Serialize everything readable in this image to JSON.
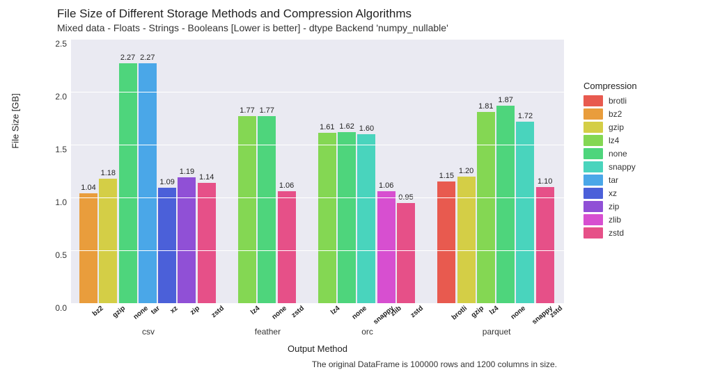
{
  "chart_data": {
    "type": "bar",
    "title": "File Size of Different Storage Methods and Compression Algorithms",
    "subtitle": "Mixed data - Floats - Strings - Booleans [Lower is better] - dtype Backend 'numpy_nullable'",
    "xlabel": "Output Method",
    "ylabel": "File Size [GB]",
    "ylim": [
      0.0,
      2.5
    ],
    "yticks": [
      0.0,
      0.5,
      1.0,
      1.5,
      2.0,
      2.5
    ],
    "legend_title": "Compression",
    "footnote": "The original DataFrame is 100000 rows and 1200 columns in size.",
    "compressions": [
      {
        "name": "brotli",
        "color": "#e85a4f"
      },
      {
        "name": "bz2",
        "color": "#e99d3c"
      },
      {
        "name": "gzip",
        "color": "#d4ce46"
      },
      {
        "name": "lz4",
        "color": "#84d753"
      },
      {
        "name": "none",
        "color": "#4ed57c"
      },
      {
        "name": "snappy",
        "color": "#49d4bd"
      },
      {
        "name": "tar",
        "color": "#4aa7e8"
      },
      {
        "name": "xz",
        "color": "#4b60d9"
      },
      {
        "name": "zip",
        "color": "#9050d6"
      },
      {
        "name": "zlib",
        "color": "#d74fd0"
      },
      {
        "name": "zstd",
        "color": "#e65088"
      }
    ],
    "groups": [
      {
        "name": "csv",
        "bars": [
          {
            "compression": "bz2",
            "value": 1.04
          },
          {
            "compression": "gzip",
            "value": 1.18
          },
          {
            "compression": "none",
            "value": 2.27
          },
          {
            "compression": "tar",
            "value": 2.27
          },
          {
            "compression": "xz",
            "value": 1.09
          },
          {
            "compression": "zip",
            "value": 1.19
          },
          {
            "compression": "zstd",
            "value": 1.14
          }
        ]
      },
      {
        "name": "feather",
        "bars": [
          {
            "compression": "lz4",
            "value": 1.77
          },
          {
            "compression": "none",
            "value": 1.77
          },
          {
            "compression": "zstd",
            "value": 1.06
          }
        ]
      },
      {
        "name": "orc",
        "bars": [
          {
            "compression": "lz4",
            "value": 1.61
          },
          {
            "compression": "none",
            "value": 1.62
          },
          {
            "compression": "snappy",
            "value": 1.6
          },
          {
            "compression": "zlib",
            "value": 1.06
          },
          {
            "compression": "zstd",
            "value": 0.95
          }
        ]
      },
      {
        "name": "parquet",
        "bars": [
          {
            "compression": "brotli",
            "value": 1.15
          },
          {
            "compression": "gzip",
            "value": 1.2
          },
          {
            "compression": "lz4",
            "value": 1.81
          },
          {
            "compression": "none",
            "value": 1.87
          },
          {
            "compression": "snappy",
            "value": 1.72
          },
          {
            "compression": "zstd",
            "value": 1.1
          }
        ]
      }
    ]
  }
}
